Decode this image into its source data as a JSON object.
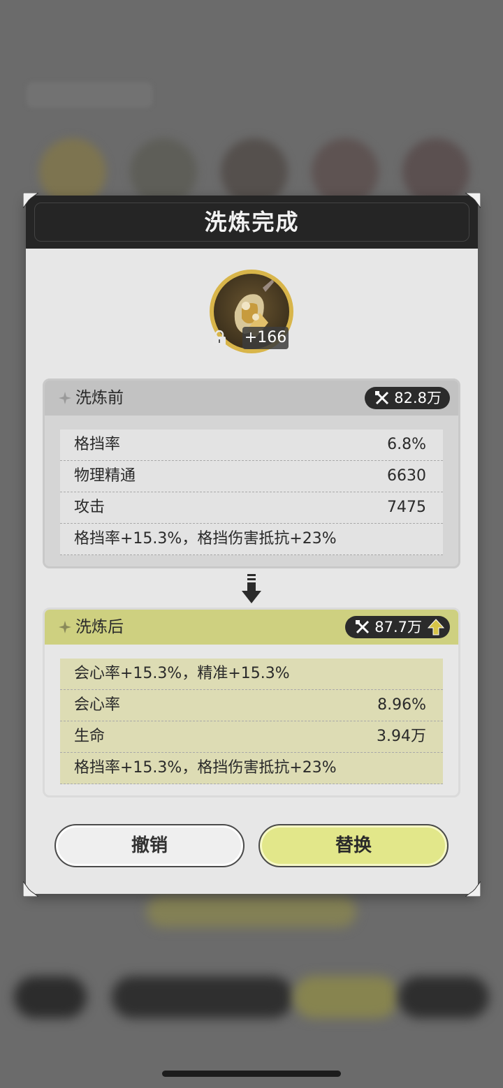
{
  "dialog": {
    "title": "洗炼完成",
    "equipment": {
      "icon": "bracer-icon",
      "level": "+166",
      "locked": true
    }
  },
  "before": {
    "label": "洗炼前",
    "power": "82.8万",
    "rows": [
      {
        "name": "格挡率",
        "value": "6.8%"
      },
      {
        "name": "物理精通",
        "value": "6630"
      },
      {
        "name": "攻击",
        "value": "7475"
      },
      {
        "name": "格挡率+15.3%，格挡伤害抵抗+23%",
        "value": ""
      }
    ]
  },
  "after": {
    "label": "洗炼后",
    "power": "87.7万",
    "rows": [
      {
        "name": "会心率+15.3%，精准+15.3%",
        "value": ""
      },
      {
        "name": "会心率",
        "value": "8.96%"
      },
      {
        "name": "生命",
        "value": "3.94万"
      },
      {
        "name": "格挡率+15.3%，格挡伤害抵抗+23%",
        "value": ""
      }
    ]
  },
  "buttons": {
    "cancel": "撤销",
    "replace": "替换"
  },
  "colors": {
    "header": "#252525",
    "after_accent": "#ced080",
    "replace_button": "#e2e78a",
    "badge": "#2b2b2b",
    "power_up": "#c9b234"
  }
}
